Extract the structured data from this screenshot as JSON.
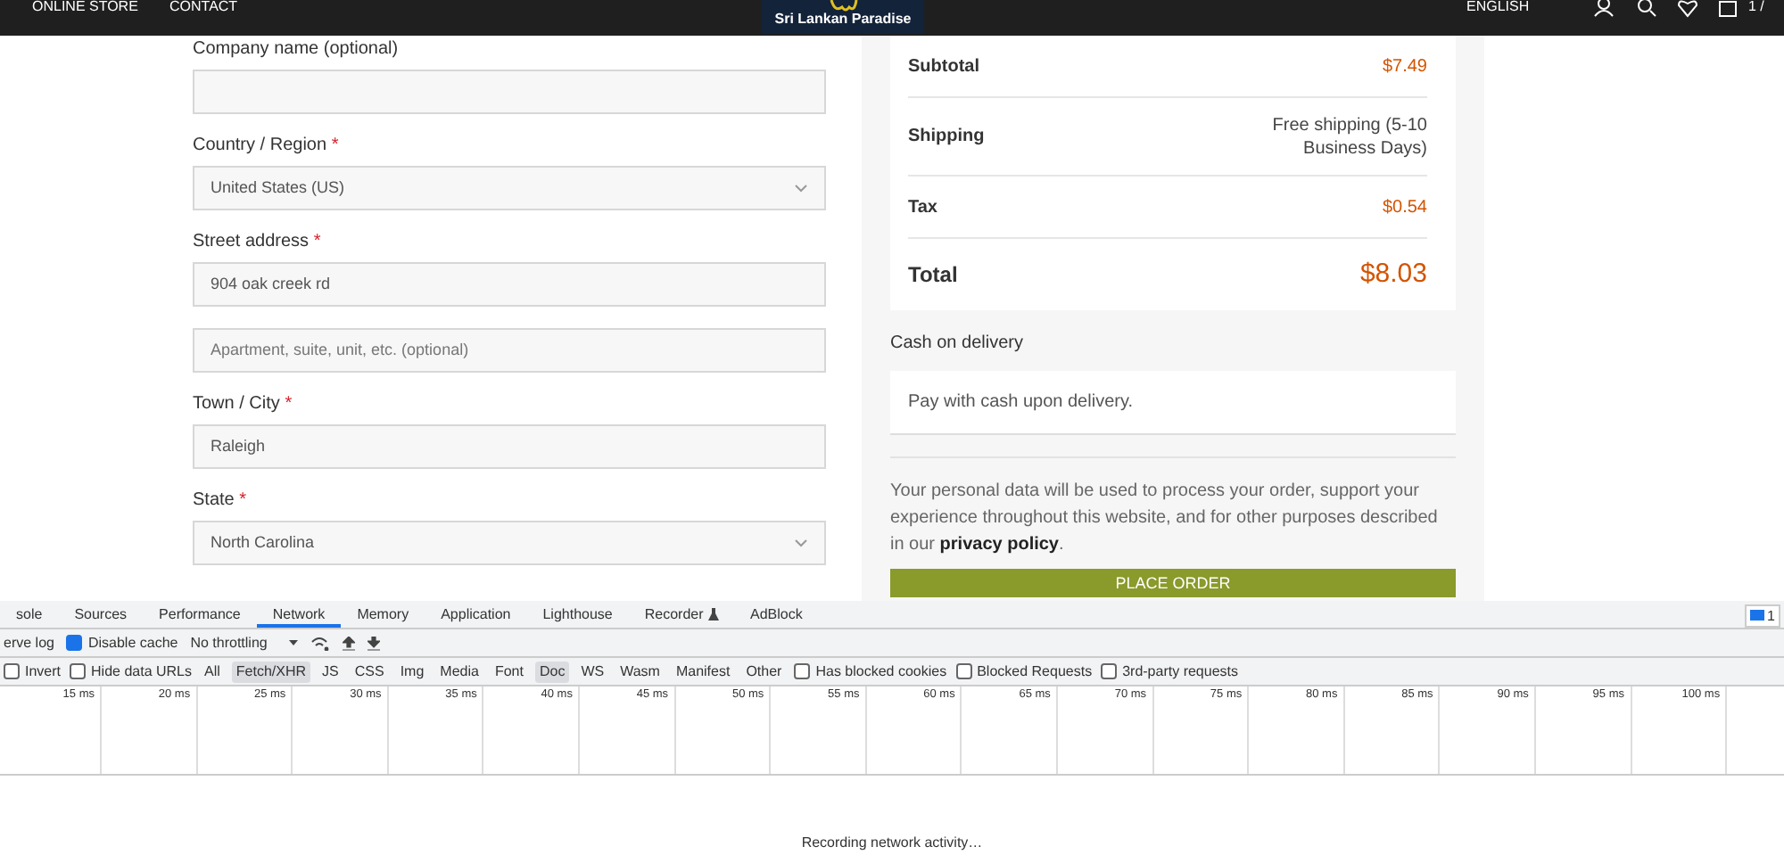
{
  "top_nav": {
    "links": [
      "ONLINE STORE",
      "CONTACT"
    ],
    "logo_text": "Sri Lankan Paradise",
    "language": "ENGLISH",
    "cart_text": "1 /"
  },
  "billing_fields": [
    {
      "label": "Company name (optional)",
      "kind": "text"
    },
    {
      "label": "Country / Region",
      "required_mark": "*",
      "kind": "select",
      "value": "United States (US)"
    },
    {
      "label": "Street address",
      "required_mark": "*",
      "kind": "text",
      "value": "904 oak creek rd"
    },
    {
      "kind": "text",
      "placeholder": "Apartment, suite, unit, etc. (optional)"
    },
    {
      "label": "Town / City",
      "required_mark": "*",
      "kind": "text",
      "value": "Raleigh"
    },
    {
      "label": "State",
      "required_mark": "*",
      "kind": "select",
      "value": "North Carolina"
    }
  ],
  "order_summary": [
    {
      "label": "Subtotal",
      "value": "$7.49",
      "kind": "amount"
    },
    {
      "label": "Shipping",
      "value": "Free shipping (5-10 Business Days)",
      "kind": "note"
    },
    {
      "label": "Tax",
      "value": "$0.54",
      "kind": "amount"
    },
    {
      "label": "Total",
      "value": "$8.03",
      "kind": "total"
    }
  ],
  "payment": {
    "method": "Cash on delivery",
    "description": "Pay with cash upon delivery."
  },
  "privacy_text": "Your personal data will be used to process your order, support your experience throughout this website, and for other purposes described in our **privacy policy**.",
  "place_order": "PLACE ORDER",
  "devtools": {
    "tabs": [
      {
        "label": "sole",
        "selected": false
      },
      {
        "label": "Sources",
        "selected": false
      },
      {
        "label": "Performance",
        "selected": false
      },
      {
        "label": "Network",
        "selected": true
      },
      {
        "label": "Memory",
        "selected": false
      },
      {
        "label": "Application",
        "selected": false
      },
      {
        "label": "Lighthouse",
        "selected": false
      },
      {
        "label": "Recorder",
        "selected": false,
        "icon": true
      },
      {
        "label": "AdBlock",
        "selected": false
      }
    ],
    "message_count": "1",
    "toolbar": [
      {
        "kind": "text",
        "label": "erve log"
      },
      {
        "kind": "checkbox",
        "label": "Disable cache",
        "checked": true
      },
      {
        "kind": "select",
        "label": "No throttling"
      },
      {
        "kind": "wifi"
      },
      {
        "kind": "upload"
      },
      {
        "kind": "download"
      }
    ],
    "filters": [
      {
        "kind": "checkbox",
        "label": "Invert",
        "checked": false
      },
      {
        "kind": "checkbox",
        "label": "Hide data URLs",
        "checked": false
      },
      {
        "kind": "type",
        "label": "All",
        "selected": false
      },
      {
        "kind": "type",
        "label": "Fetch/XHR",
        "selected": true
      },
      {
        "kind": "type",
        "label": "JS",
        "selected": false
      },
      {
        "kind": "type",
        "label": "CSS",
        "selected": false
      },
      {
        "kind": "type",
        "label": "Img",
        "selected": false
      },
      {
        "kind": "type",
        "label": "Media",
        "selected": false
      },
      {
        "kind": "type",
        "label": "Font",
        "selected": false
      },
      {
        "kind": "type",
        "label": "Doc",
        "selected": true
      },
      {
        "kind": "type",
        "label": "WS",
        "selected": false
      },
      {
        "kind": "type",
        "label": "Wasm",
        "selected": false
      },
      {
        "kind": "type",
        "label": "Manifest",
        "selected": false
      },
      {
        "kind": "type",
        "label": "Other",
        "selected": false
      },
      {
        "kind": "checkbox",
        "label": "Has blocked cookies",
        "checked": false
      },
      {
        "kind": "checkbox",
        "label": "Blocked Requests",
        "checked": false
      },
      {
        "kind": "checkbox",
        "label": "3rd-party requests",
        "checked": false
      }
    ],
    "ticks": [
      "15 ms",
      "20 ms",
      "25 ms",
      "30 ms",
      "35 ms",
      "40 ms",
      "45 ms",
      "50 ms",
      "55 ms",
      "60 ms",
      "65 ms",
      "70 ms",
      "75 ms",
      "80 ms",
      "85 ms",
      "90 ms",
      "95 ms",
      "100 ms"
    ],
    "status": "Recording network activity…"
  }
}
